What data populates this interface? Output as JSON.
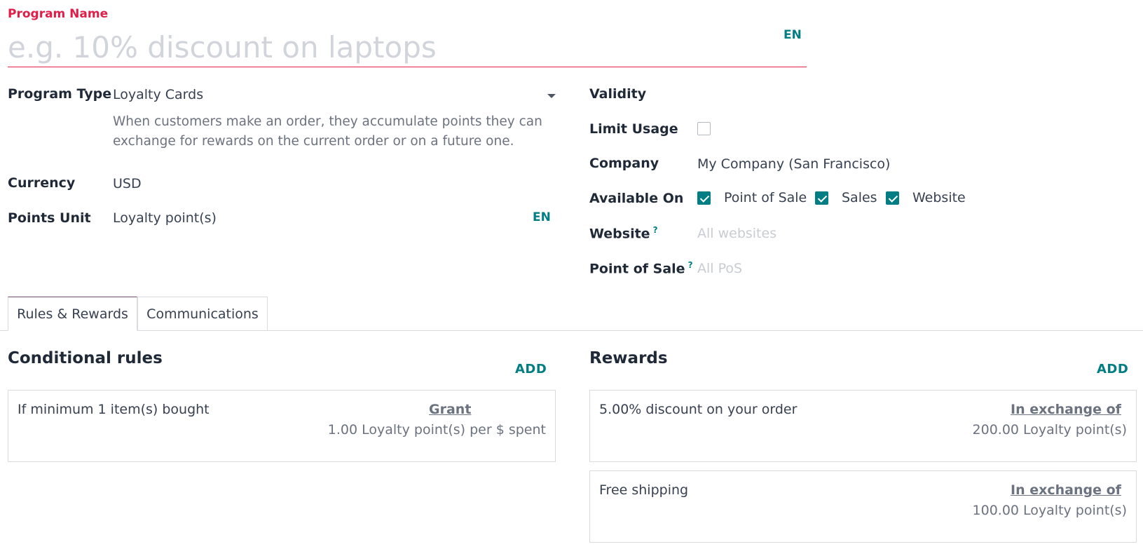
{
  "program_name": {
    "label": "Program Name",
    "placeholder": "e.g. 10% discount on laptops",
    "lang": "EN"
  },
  "left_fields": {
    "program_type": {
      "label": "Program Type",
      "value": "Loyalty Cards",
      "description_line1": "When customers make an order, they accumulate points they can",
      "description_line2": "exchange for rewards on the current order or on a future one."
    },
    "currency": {
      "label": "Currency",
      "value": "USD"
    },
    "points_unit": {
      "label": "Points Unit",
      "value": "Loyalty point(s)",
      "lang": "EN"
    }
  },
  "right_fields": {
    "validity": {
      "label": "Validity"
    },
    "limit_usage": {
      "label": "Limit Usage",
      "checked": false
    },
    "company": {
      "label": "Company",
      "value": "My Company (San Francisco)"
    },
    "available_on": {
      "label": "Available On",
      "options": [
        {
          "label": "Point of Sale",
          "checked": true
        },
        {
          "label": "Sales",
          "checked": true
        },
        {
          "label": "Website",
          "checked": true
        }
      ]
    },
    "website": {
      "label": "Website",
      "help": "?",
      "placeholder": "All websites"
    },
    "point_of_sale": {
      "label": "Point of Sale",
      "help": "?",
      "placeholder": "All PoS"
    }
  },
  "tabs": [
    {
      "label": "Rules & Rewards",
      "active": true
    },
    {
      "label": "Communications",
      "active": false
    }
  ],
  "rules": {
    "title": "Conditional rules",
    "add_label": "ADD",
    "items": [
      {
        "condition": "If minimum 1 item(s) bought",
        "action_title": "Grant",
        "action_value": "1.00 Loyalty point(s) per $ spent"
      }
    ]
  },
  "rewards": {
    "title": "Rewards",
    "add_label": "ADD",
    "items": [
      {
        "reward": "5.00% discount on your order",
        "cost_title": "In exchange of",
        "cost_value": "200.00 Loyalty point(s)"
      },
      {
        "reward": "Free shipping",
        "cost_title": "In exchange of",
        "cost_value": "100.00 Loyalty point(s)"
      }
    ]
  },
  "colors": {
    "accent": "#017e84",
    "required": "#e11d48",
    "tab_active": "#714b67"
  }
}
